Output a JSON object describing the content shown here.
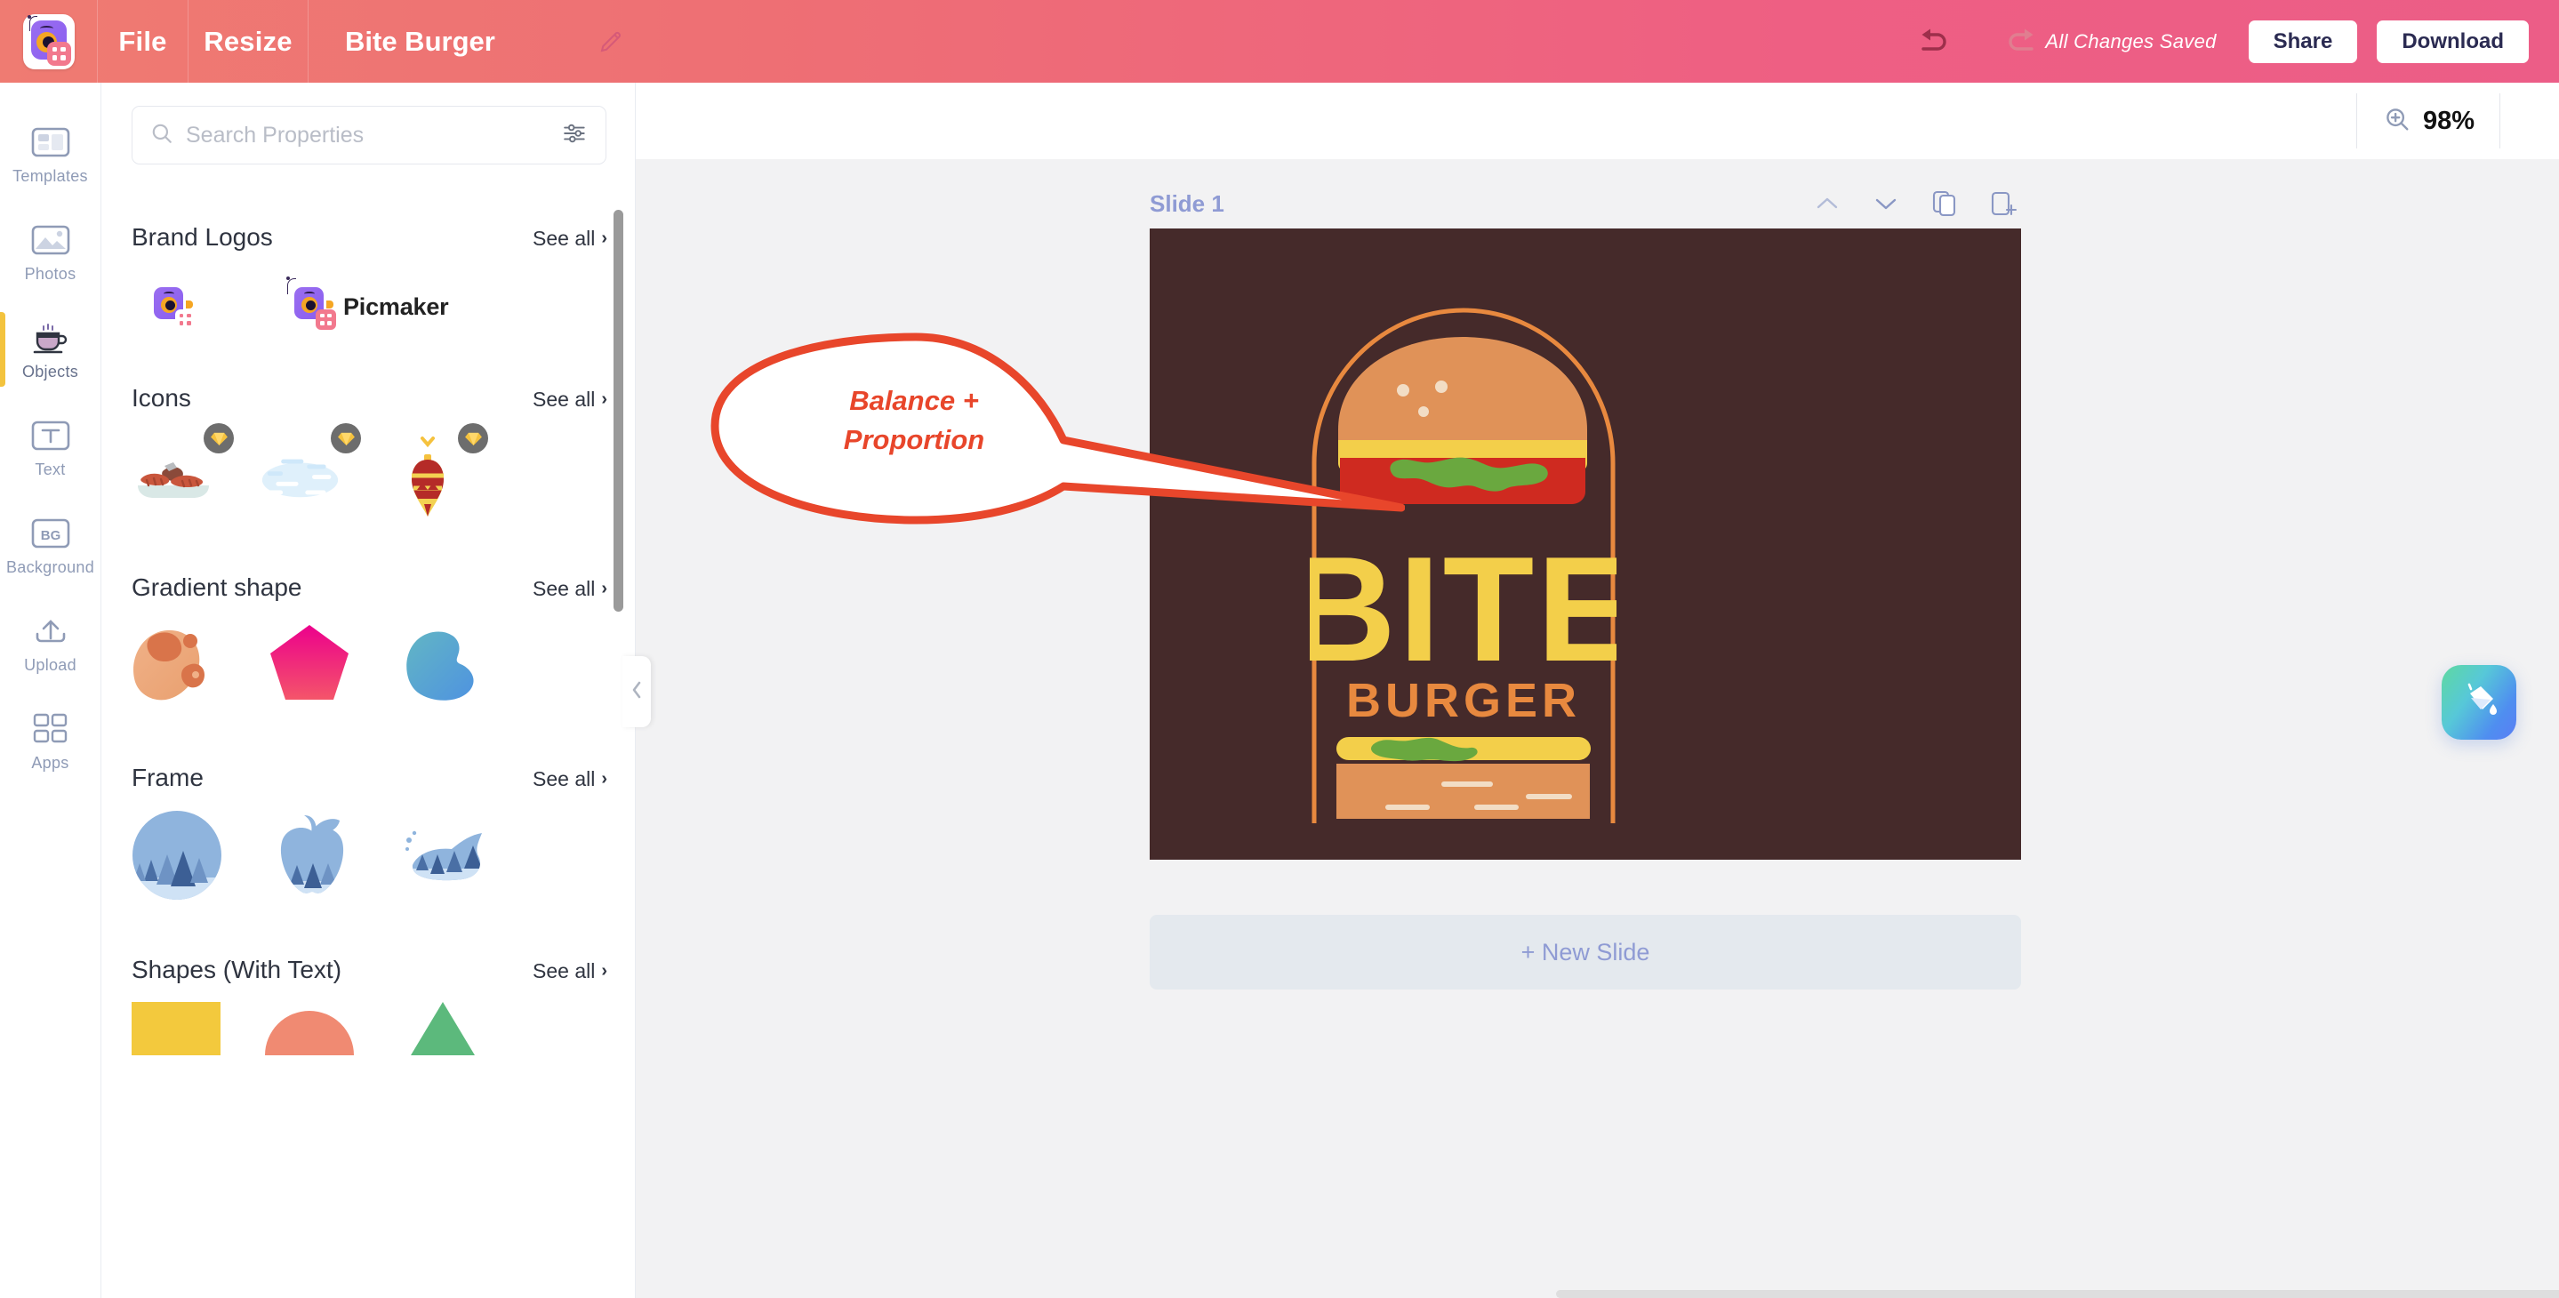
{
  "header": {
    "logo_icon": "picmaker-logo-icon",
    "file_label": "File",
    "resize_label": "Resize",
    "project_title": "Bite Burger",
    "pencil_icon": "pencil-edit-icon",
    "undo_icon": "undo-arrow-icon",
    "redo_icon": "redo-arrow-icon",
    "save_status": "All Changes Saved",
    "share_label": "Share",
    "download_label": "Download",
    "colors": {
      "gradient_start": "#ef7b72",
      "gradient_end": "#ec5d87",
      "button_text": "#2b2b52"
    }
  },
  "sidebar": {
    "items": [
      {
        "label": "Templates",
        "icon": "templates-icon",
        "active": false
      },
      {
        "label": "Photos",
        "icon": "photos-icon",
        "active": false
      },
      {
        "label": "Objects",
        "icon": "objects-coffee-cup-icon",
        "active": true
      },
      {
        "label": "Text",
        "icon": "text-icon",
        "active": false
      },
      {
        "label": "Background",
        "icon": "background-bg-icon",
        "active": false
      },
      {
        "label": "Upload",
        "icon": "upload-icon",
        "active": false
      },
      {
        "label": "Apps",
        "icon": "apps-grid-icon",
        "active": false
      }
    ],
    "active_indicator_color": "#f3c33e"
  },
  "panel": {
    "search": {
      "placeholder": "Search Properties",
      "value": "",
      "search_icon": "search-icon",
      "filter_icon": "filter-sliders-icon"
    },
    "see_all_label": "See all",
    "chevron": "›",
    "sections": [
      {
        "title": "Brand Logos",
        "items": [
          {
            "name": "picmaker-logo-mark",
            "type": "logo-mark"
          },
          {
            "name": "picmaker-wordmark",
            "type": "logo-wordmark",
            "text": "Picmaker"
          }
        ]
      },
      {
        "title": "Icons",
        "items": [
          {
            "name": "sausage-platter-icon",
            "premium": true
          },
          {
            "name": "clouds-icon",
            "premium": true
          },
          {
            "name": "christmas-ornament-icon",
            "premium": true
          }
        ]
      },
      {
        "title": "Gradient shape",
        "items": [
          {
            "name": "orange-blob-shape"
          },
          {
            "name": "pink-pentagon-shape"
          },
          {
            "name": "teal-blob-shape"
          }
        ]
      },
      {
        "title": "Frame",
        "items": [
          {
            "name": "circle-forest-frame"
          },
          {
            "name": "apple-forest-frame"
          },
          {
            "name": "whale-forest-frame"
          }
        ]
      },
      {
        "title": "Shapes (With Text)",
        "items": [
          {
            "name": "yellow-rectangle-shape"
          },
          {
            "name": "orange-semicircle-shape"
          },
          {
            "name": "green-triangle-shape"
          }
        ]
      }
    ],
    "collapse_icon": "chevron-left-icon"
  },
  "workspace": {
    "zoom": {
      "icon": "zoom-in-icon",
      "value": "98%"
    },
    "slide": {
      "label": "Slide 1",
      "move_up_icon": "chevron-up-icon",
      "move_down_icon": "chevron-down-icon",
      "duplicate_icon": "duplicate-slide-icon",
      "add_icon": "add-slide-icon"
    },
    "new_slide_label": "+ New Slide",
    "canvas_bg": "#452a2a",
    "design": {
      "brand_name": "BITE",
      "brand_subname": "BURGER",
      "arch_color": "#e8893f",
      "bun_color": "#e09258",
      "cheese_color": "#f3cf4a",
      "tomato_color": "#cf2a20",
      "lettuce_color": "#6aa83f",
      "title_color": "#f3cf4a",
      "subtitle_color": "#e8893f"
    },
    "callout": {
      "text_line1": "Balance +",
      "text_line2": "Proportion",
      "color": "#e8462b"
    },
    "fab": {
      "icon": "paint-bucket-fill-icon"
    }
  }
}
